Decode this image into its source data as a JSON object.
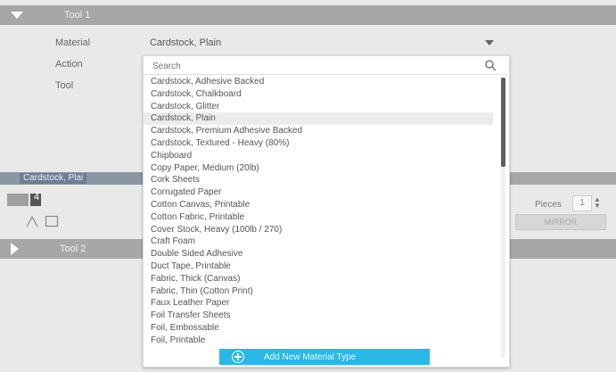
{
  "section1": {
    "title": "Tool 1"
  },
  "section2": {
    "title": "Tool 2"
  },
  "rows": {
    "material_label": "Material",
    "action_label": "Action",
    "tool_label": "Tool"
  },
  "material_select": {
    "value": "Cardstock, Plain"
  },
  "search": {
    "placeholder": "Search"
  },
  "materials": [
    "Cardstock, Adhesive Backed",
    "Cardstock, Chalkboard",
    "Cardstock, Glitter",
    "Cardstock, Plain",
    "Cardstock, Premium Adhesive Backed",
    "Cardstock, Textured - Heavy (80%)",
    "Chipboard",
    "Copy Paper, Medium (20lb)",
    "Cork Sheets",
    "Corrugated Paper",
    "Cotton Canvas, Printable",
    "Cotton Fabric, Printable",
    "Cover Stock, Heavy (100lb / 270)",
    "Craft Foam",
    "Double Sided Adhesive",
    "Duct Tape, Printable",
    "Fabric, Thick (Canvas)",
    "Fabric, Thin (Cotton Print)",
    "Faux Leather Paper",
    "Foil Transfer Sheets",
    "Foil, Embossable",
    "Foil, Printable"
  ],
  "selected_index": 3,
  "add_button": {
    "label": "Add New Material Type"
  },
  "layer": {
    "name": "Cardstock, Plai"
  },
  "tool_number": "4",
  "pieces": {
    "label": "Pieces",
    "value": "1"
  },
  "mirror_button": {
    "label": "MIRROR"
  },
  "colors": {
    "header": "#a7a7a7",
    "accent": "#2ab8e6",
    "scroll_thumb": "#5e5e5e",
    "layer_bar": "#8a97a4"
  }
}
